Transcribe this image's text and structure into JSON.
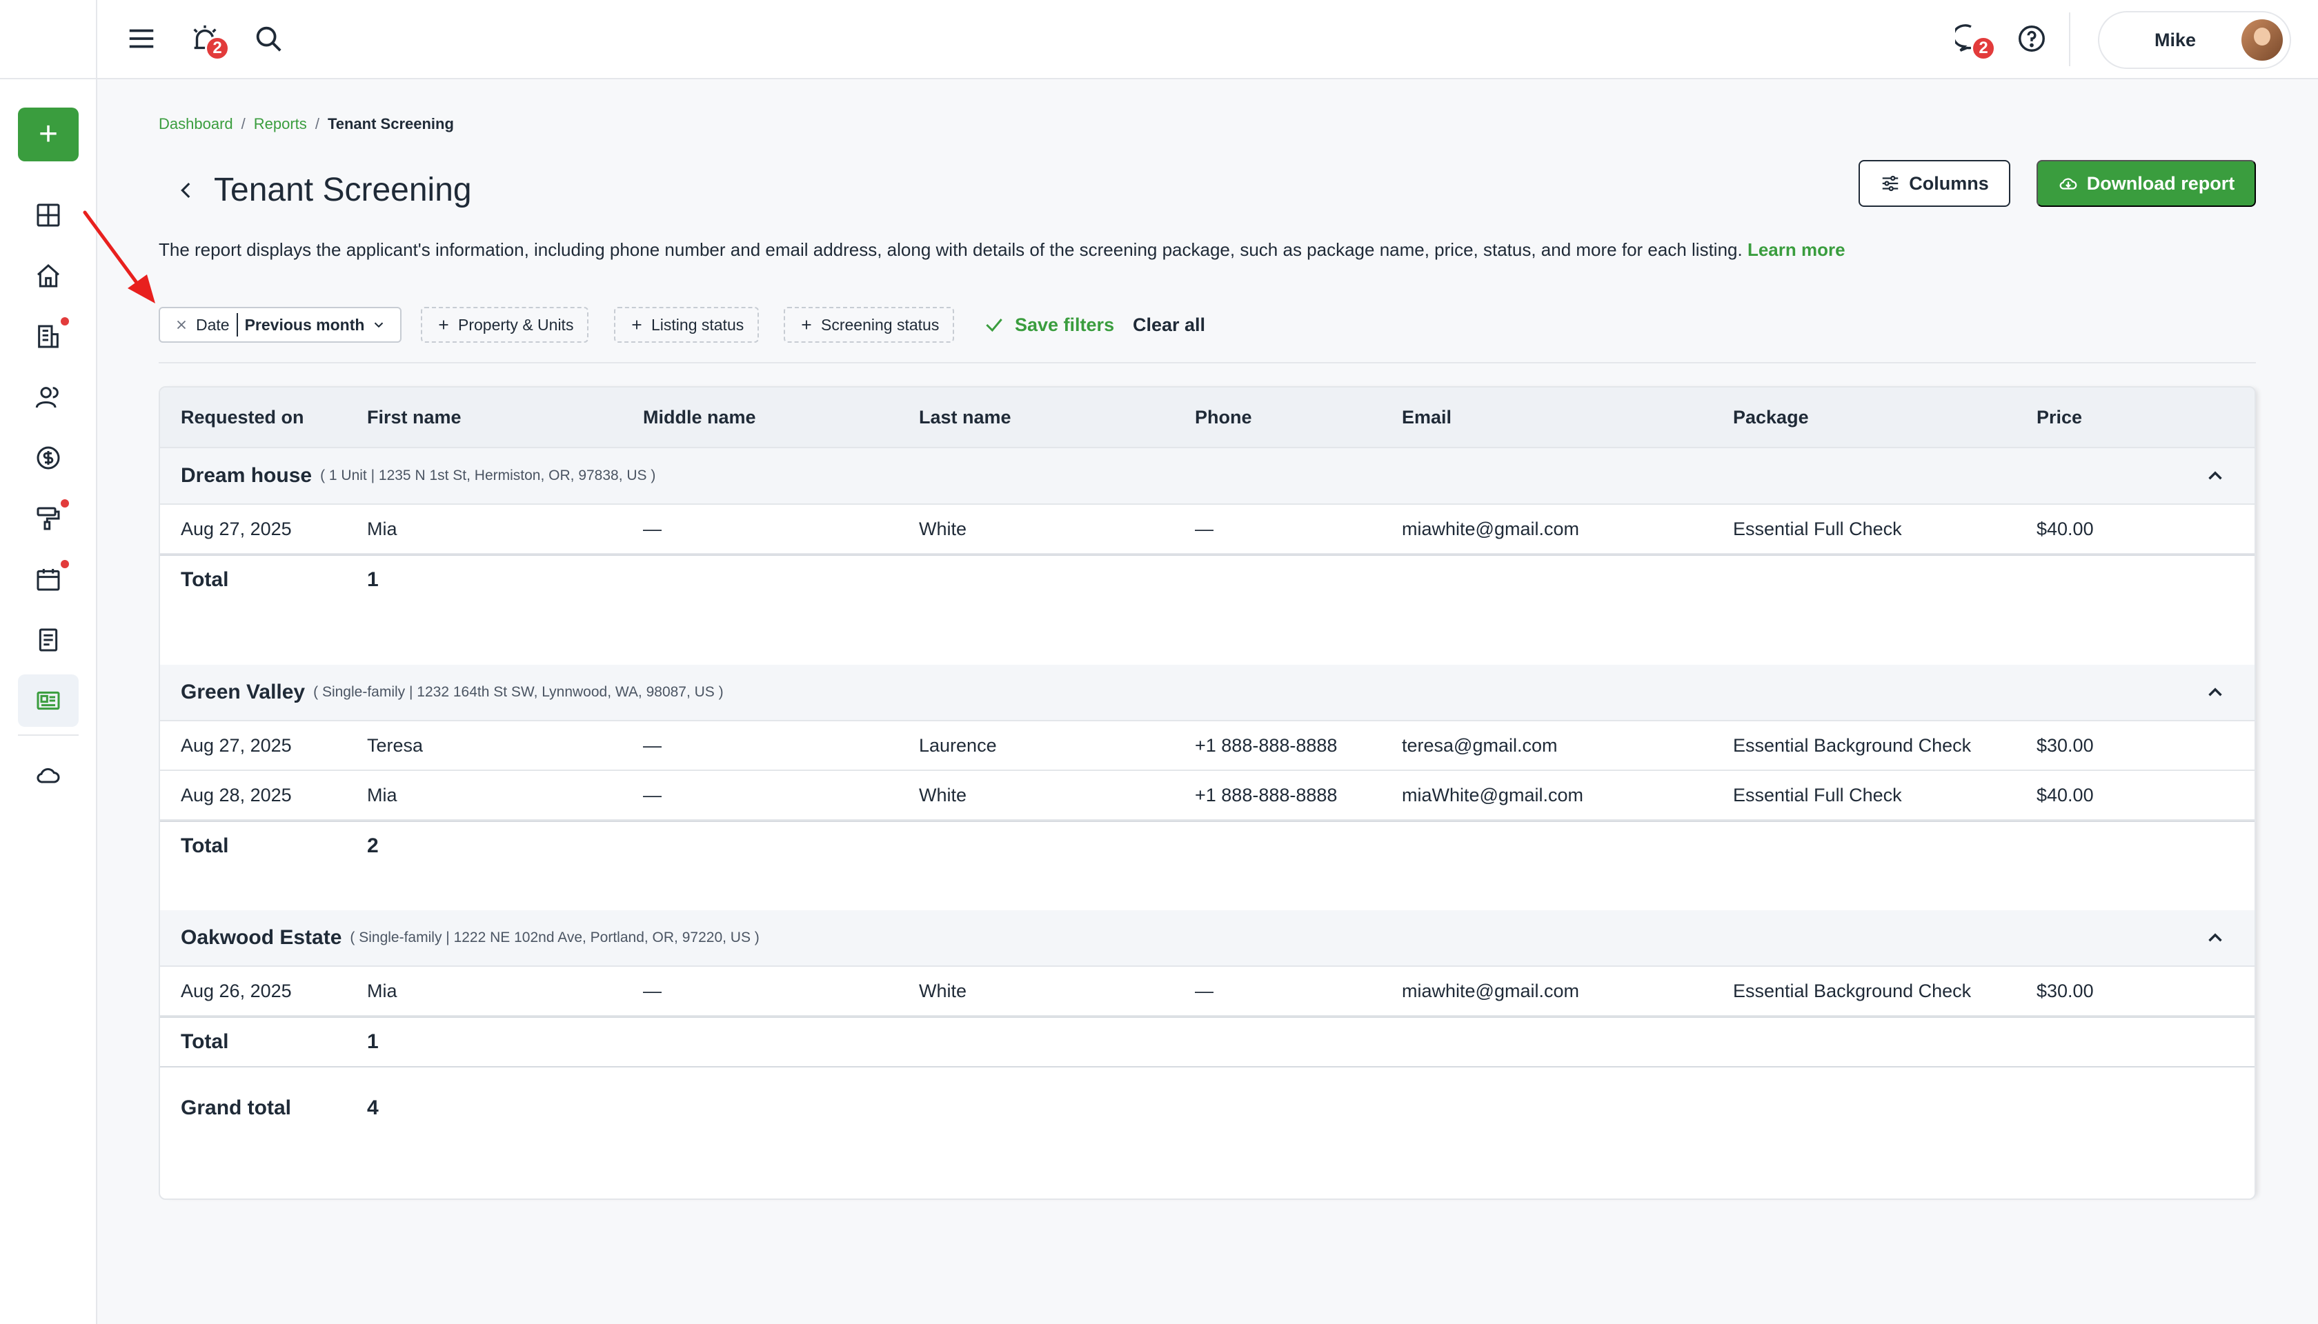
{
  "topbar": {
    "notifications_count": "2",
    "messages_count": "2",
    "user_name": "Mike"
  },
  "breadcrumb": {
    "items": [
      "Dashboard",
      "Reports"
    ],
    "current": "Tenant Screening",
    "separator": "/"
  },
  "page": {
    "title": "Tenant Screening",
    "columns_label": "Columns",
    "download_label": "Download report",
    "description": "The report displays the applicant's information, including phone number and email address, along with details of the screening package, such as package name, price, status, and more for each listing.",
    "learn_more": "Learn more"
  },
  "filters": {
    "date_label": "Date",
    "date_value": "Previous month",
    "property_units": "Property & Units",
    "listing_status": "Listing status",
    "screening_status": "Screening status",
    "save_filters": "Save filters",
    "clear_all": "Clear all"
  },
  "table": {
    "columns": [
      "Requested on",
      "First name",
      "Middle name",
      "Last name",
      "Phone",
      "Email",
      "Package",
      "Price"
    ],
    "groups": [
      {
        "name": "Dream house",
        "meta": "( 1 Unit | 1235 N 1st St, Hermiston, OR, 97838, US )",
        "rows": [
          [
            "Aug 27, 2025",
            "Mia",
            "—",
            "White",
            "—",
            "miawhite@gmail.com",
            "Essential Full Check",
            "$40.00"
          ]
        ],
        "total_label": "Total",
        "total": "1"
      },
      {
        "name": "Green Valley",
        "meta": "( Single-family | 1232 164th St SW, Lynnwood, WA, 98087, US )",
        "rows": [
          [
            "Aug 27, 2025",
            "Teresa",
            "—",
            "Laurence",
            "+1 888-888-8888",
            "teresa@gmail.com",
            "Essential Background Check",
            "$30.00"
          ],
          [
            "Aug 28, 2025",
            "Mia",
            "—",
            "White",
            "+1 888-888-8888",
            "miaWhite@gmail.com",
            "Essential Full Check",
            "$40.00"
          ]
        ],
        "total_label": "Total",
        "total": "2"
      },
      {
        "name": "Oakwood Estate",
        "meta": "( Single-family | 1222 NE 102nd Ave, Portland, OR, 97220, US )",
        "rows": [
          [
            "Aug 26, 2025",
            "Mia",
            "—",
            "White",
            "—",
            "miawhite@gmail.com",
            "Essential Background Check",
            "$30.00"
          ]
        ],
        "total_label": "Total",
        "total": "1"
      }
    ],
    "grand_total_label": "Grand total",
    "grand_total": "4"
  },
  "colors": {
    "accent": "#3a9d3e",
    "badge": "#e23b3b",
    "text": "#1f2a37",
    "arrow": "#e8201e"
  },
  "icons": {
    "sidebar": [
      "plus-icon",
      "dashboard-grid-icon",
      "home-icon",
      "building-icon",
      "people-icon",
      "dollar-icon",
      "paint-roller-icon",
      "calendar-icon",
      "document-icon",
      "reports-icon",
      "cloud-icon"
    ],
    "topbar": [
      "menu-icon",
      "alarm-icon",
      "search-icon",
      "chat-icon",
      "help-icon"
    ]
  }
}
